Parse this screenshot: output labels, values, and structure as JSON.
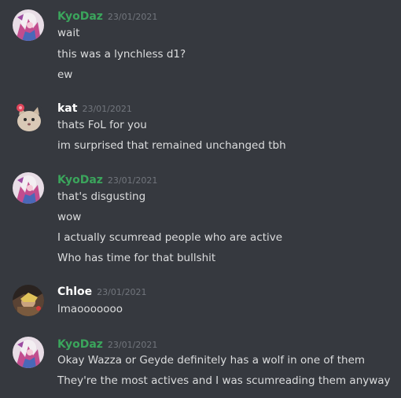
{
  "colors": {
    "background": "#36393f",
    "text": "#dcddde",
    "timestamp": "#72767d",
    "kyodaz": "#3ba55c",
    "white_name": "#ffffff"
  },
  "messages": [
    {
      "author": "KyoDaz",
      "author_color": "#3ba55c",
      "avatar_icon": "anime-character-avatar-icon",
      "timestamp": "23/01/2021",
      "lines": [
        "wait",
        "this was a lynchless d1?",
        "ew"
      ]
    },
    {
      "author": "kat",
      "author_color": "#ffffff",
      "avatar_icon": "cat-with-flower-avatar-icon",
      "timestamp": "23/01/2021",
      "lines": [
        "thats FoL for you",
        "im surprised that remained unchanged tbh"
      ]
    },
    {
      "author": "KyoDaz",
      "author_color": "#3ba55c",
      "avatar_icon": "anime-character-avatar-icon",
      "timestamp": "23/01/2021",
      "lines": [
        "that's disgusting",
        "wow",
        "I actually scumread people who are active",
        "Who has time for that bullshit"
      ]
    },
    {
      "author": "Chloe",
      "author_color": "#ffffff",
      "avatar_icon": "dark-character-avatar-icon",
      "timestamp": "23/01/2021",
      "lines": [
        "lmaooooooo"
      ]
    },
    {
      "author": "KyoDaz",
      "author_color": "#3ba55c",
      "avatar_icon": "anime-character-avatar-icon",
      "timestamp": "23/01/2021",
      "lines": [
        "Okay Wazza or Geyde definitely has a wolf in one of them",
        "They're the most actives and I was scumreading them anyway"
      ]
    }
  ]
}
